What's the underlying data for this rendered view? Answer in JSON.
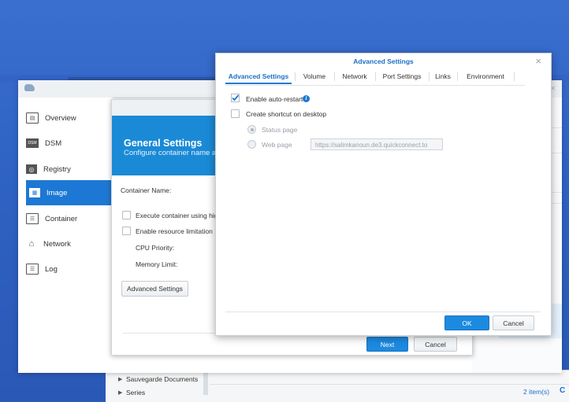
{
  "docker": {
    "nav": [
      {
        "label": "Overview",
        "icon": "overview-icon"
      },
      {
        "label": "DSM",
        "icon": "dsm-icon",
        "icon_text": "DSM"
      },
      {
        "label": "Registry",
        "icon": "registry-icon"
      },
      {
        "label": "Image",
        "icon": "image-icon"
      },
      {
        "label": "Container",
        "icon": "container-icon"
      },
      {
        "label": "Network",
        "icon": "network-icon"
      },
      {
        "label": "Log",
        "icon": "log-icon"
      }
    ],
    "active_nav": "Image",
    "close_glyph": "×"
  },
  "general": {
    "title": "General Settings",
    "subtitle": "Configure container name and",
    "container_name_label": "Container Name:",
    "options": {
      "high_privilege": "Execute container using high",
      "resource_limit": "Enable resource limitation",
      "cpu_priority": "CPU Priority:",
      "memory_limit": "Memory Limit:"
    },
    "advanced_btn": "Advanced Settings",
    "next_btn": "Next",
    "cancel_btn": "Cancel"
  },
  "advanced": {
    "title": "Advanced Settings",
    "close_glyph": "×",
    "tabs": [
      "Advanced Settings",
      "Volume",
      "Network",
      "Port Settings",
      "Links",
      "Environment"
    ],
    "active_tab": "Advanced Settings",
    "auto_restart_label": "Enable auto-restart",
    "auto_restart_checked": true,
    "shortcut_label": "Create shortcut on desktop",
    "shortcut_checked": false,
    "status_page_label": "Status page",
    "web_page_label": "Web page",
    "web_page_value": "https://salimkanoun.de3.quickconnect.to",
    "ok_btn": "OK",
    "cancel_btn": "Cancel"
  },
  "file_station": {
    "items": [
      "Sauvegarde Documents",
      "Series"
    ],
    "count": "2 item(s)"
  },
  "colors": {
    "accent": "#1c78d4",
    "banner": "#1a8ad6",
    "desktop": "#2f63c4"
  }
}
